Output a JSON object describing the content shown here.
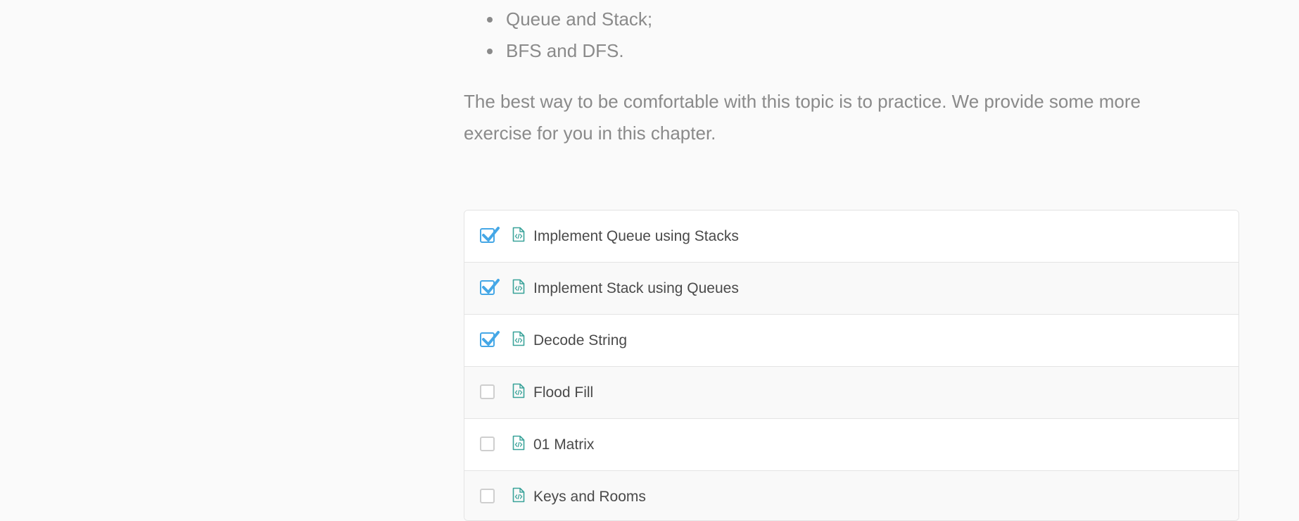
{
  "bullets": [
    "Queue and Stack;",
    "BFS and DFS."
  ],
  "paragraph": "The best way to be comfortable with this topic is to practice. We provide some more exercise for you in this chapter.",
  "problems": [
    {
      "title": "Implement Queue using Stacks",
      "completed": true
    },
    {
      "title": "Implement Stack using Queues",
      "completed": true
    },
    {
      "title": "Decode String",
      "completed": true
    },
    {
      "title": "Flood Fill",
      "completed": false
    },
    {
      "title": "01 Matrix",
      "completed": false
    },
    {
      "title": "Keys and Rooms",
      "completed": false
    }
  ],
  "icons": {
    "checkbox_checked": "checkmark-icon",
    "problem": "code-file-icon"
  },
  "colors": {
    "accent_blue": "#45a7e6",
    "icon_teal": "#3aa39a",
    "text_gray": "#8a8a8a",
    "title_text": "#4a4a4a"
  }
}
